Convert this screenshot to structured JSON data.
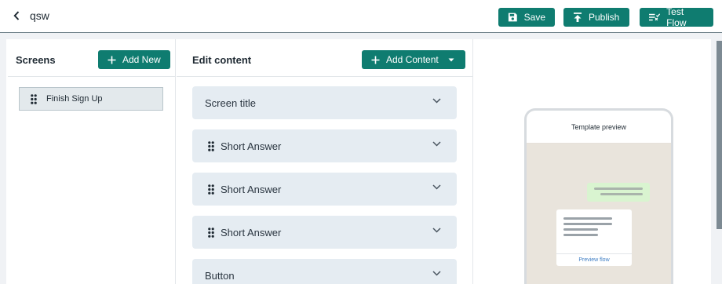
{
  "header": {
    "back_icon": "chevron-left-icon",
    "title": "qsw",
    "save_label": "Save",
    "publish_label": "Publish",
    "test_flow_label": "Test Flow",
    "accent": "#0f7c70"
  },
  "screens": {
    "title": "Screens",
    "add_new_label": "Add New",
    "items": [
      {
        "label": "Finish Sign Up"
      }
    ]
  },
  "edit": {
    "title": "Edit content",
    "add_content_label": "Add Content",
    "rows": [
      {
        "label": "Screen title",
        "draggable": false
      },
      {
        "label": "Short Answer",
        "draggable": true
      },
      {
        "label": "Short Answer",
        "draggable": true
      },
      {
        "label": "Short Answer",
        "draggable": true
      },
      {
        "label": "Button",
        "draggable": false
      }
    ]
  },
  "preview": {
    "header": "Template preview",
    "link": "Preview flow"
  }
}
